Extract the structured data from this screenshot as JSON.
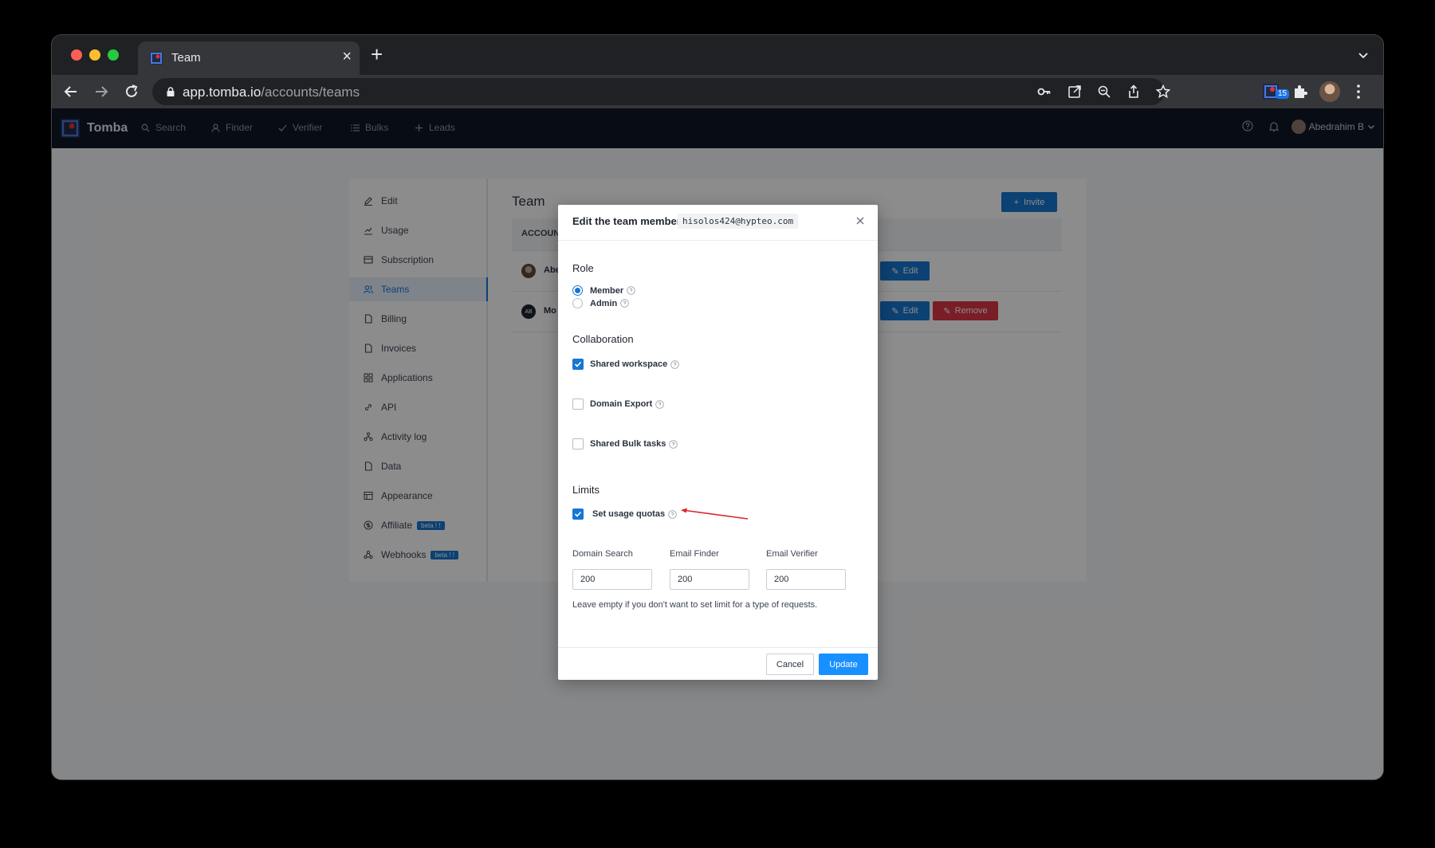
{
  "browser": {
    "tab_title": "Team",
    "url_host": "app.tomba.io",
    "url_path": "/accounts/teams",
    "extension_badge": "15"
  },
  "app": {
    "brand": "Tomba",
    "nav": [
      {
        "label": "Search",
        "icon": "search-icon"
      },
      {
        "label": "Finder",
        "icon": "user-icon"
      },
      {
        "label": "Verifier",
        "icon": "check-icon"
      },
      {
        "label": "Bulks",
        "icon": "list-icon"
      },
      {
        "label": "Leads",
        "icon": "plus-icon"
      }
    ],
    "user_name": "Abedrahim B"
  },
  "sidebar": {
    "items": [
      {
        "label": "Edit",
        "icon": "pencil-icon"
      },
      {
        "label": "Usage",
        "icon": "chart-icon"
      },
      {
        "label": "Subscription",
        "icon": "card-icon"
      },
      {
        "label": "Teams",
        "icon": "team-icon",
        "active": true
      },
      {
        "label": "Billing",
        "icon": "file-icon"
      },
      {
        "label": "Invoices",
        "icon": "file-icon"
      },
      {
        "label": "Applications",
        "icon": "grid-icon"
      },
      {
        "label": "API",
        "icon": "link-icon"
      },
      {
        "label": "Activity log",
        "icon": "cluster-icon"
      },
      {
        "label": "Data",
        "icon": "file-icon"
      },
      {
        "label": "Appearance",
        "icon": "layout-icon"
      },
      {
        "label": "Affiliate",
        "icon": "dollar-icon",
        "badge": "beta ! !"
      },
      {
        "label": "Webhooks",
        "icon": "webhook-icon",
        "badge": "beta ! !"
      }
    ]
  },
  "team": {
    "title": "Team",
    "invite_label": "Invite",
    "column_header": "ACCOUN",
    "rows": [
      {
        "name": "Abe",
        "avatar": "photo",
        "edit_label": "Edit"
      },
      {
        "name": "Mo",
        "avatar_initials": "AB",
        "edit_label": "Edit",
        "remove_label": "Remove"
      }
    ]
  },
  "modal": {
    "title": "Edit the team member",
    "email": "hisolos424@hypteo.com",
    "role_title": "Role",
    "roles": [
      {
        "label": "Member",
        "selected": true
      },
      {
        "label": "Admin",
        "selected": false
      }
    ],
    "collab_title": "Collaboration",
    "collab": [
      {
        "label": "Shared workspace",
        "checked": true
      },
      {
        "label": "Domain Export",
        "checked": false
      },
      {
        "label": "Shared Bulk tasks",
        "checked": false
      }
    ],
    "limits_title": "Limits",
    "quota_label": "Set usage quotas",
    "quota_checked": true,
    "quota_fields": [
      {
        "label": "Domain Search",
        "value": "200"
      },
      {
        "label": "Email Finder",
        "value": "200"
      },
      {
        "label": "Email Verifier",
        "value": "200"
      }
    ],
    "hint": "Leave empty if you don't want to set limit for a type of requests.",
    "cancel_label": "Cancel",
    "update_label": "Update"
  },
  "colors": {
    "accent": "#1677d2",
    "danger": "#dc3545",
    "nav_bg": "#0f1726",
    "annotation_arrow": "#d9262b"
  }
}
